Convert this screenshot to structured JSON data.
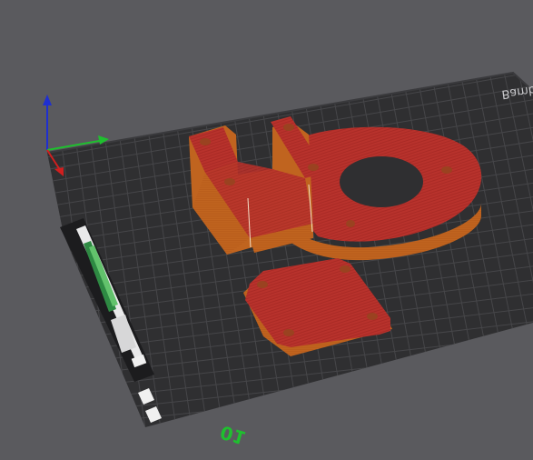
{
  "viewport": {
    "background": "#5a5a5e",
    "plate_label": "Bambu Textured PEI Plate",
    "plate_number": "01",
    "plate_color": "#2f2f31",
    "grid_color": "#464649",
    "part_top_color": "#b8322c",
    "part_side_color": "#c0641f",
    "axes": {
      "x_color": "#1fbf2f",
      "y_color": "#d01f1f",
      "z_color": "#1f2fd0"
    }
  }
}
